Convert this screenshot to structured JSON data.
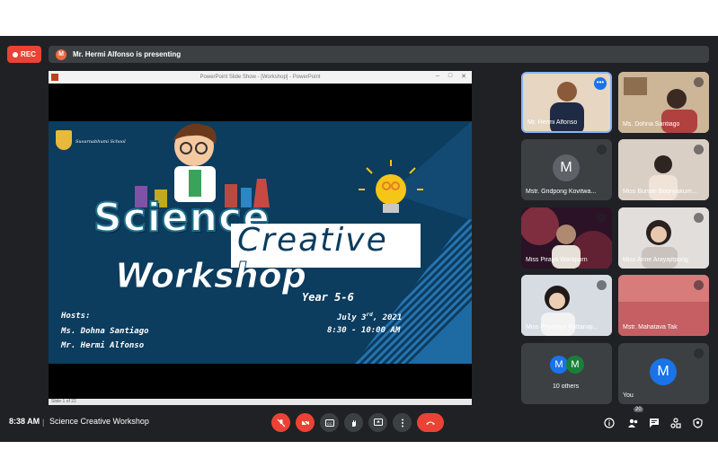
{
  "top_bar": {
    "rec_label": "REC",
    "presenter_initial": "M",
    "presenting_text": "Mr. Hermi Alfonso is presenting"
  },
  "presentation": {
    "window_title": "PowerPoint Slide Show - [Workshop] - PowerPoint",
    "status_text": "Slide 1 of 22",
    "slide": {
      "school": "Suvarnabhumi School",
      "title_line1": "Science",
      "title_line2": "Creative",
      "title_line3": "Workshop",
      "year": "Year 5-6",
      "hosts_heading": "Hosts:",
      "host1": "Ms. Dohna Santiago",
      "host2": "Mr. Hermi Alfonso",
      "date_main": "July 3",
      "date_suffix": "rd",
      "date_year": ", 2021",
      "time": "8:30 - 10:00 AM"
    }
  },
  "participants": [
    {
      "name": "Mr. Hermi Alfonso"
    },
    {
      "name": "Ms. Dohna Santiago"
    },
    {
      "name": "Mstr. Gridpong Kovitwa...",
      "initial": "M"
    },
    {
      "name": "Miss Bunsin Boonyakum..."
    },
    {
      "name": "Miss Piraya Waraporn"
    },
    {
      "name": "Miss Anne Arayajitpong"
    },
    {
      "name": "Miss Phuchiya Rattanaji..."
    },
    {
      "name": "Mstr. Mahatava Tak"
    },
    {
      "name": "10 others",
      "initials": [
        "M",
        "M"
      ]
    },
    {
      "name": "You",
      "initial": "M"
    }
  ],
  "bottom_bar": {
    "time": "8:38 AM",
    "separator": "|",
    "meeting_title": "Science Creative Workshop",
    "participant_count": "20"
  },
  "colors": {
    "background": "#202124",
    "tile": "#3c4043",
    "accent_red": "#ea4335",
    "accent_blue": "#1a73e8",
    "slide_bg": "#0c3c5e"
  }
}
